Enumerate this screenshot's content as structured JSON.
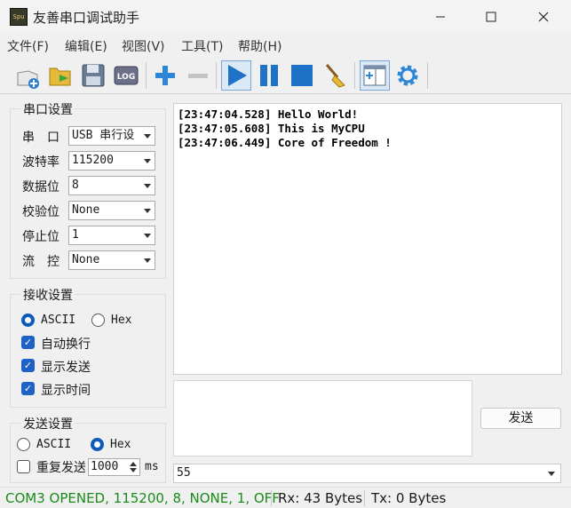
{
  "window": {
    "title": "友善串口调试助手",
    "icon_label": "Spu"
  },
  "menu": [
    "文件(F)",
    "编辑(E)",
    "视图(V)",
    "工具(T)",
    "帮助(H)"
  ],
  "toolbar": {
    "log_label": "LOG",
    "accent": "#1e73c8"
  },
  "serial_settings": {
    "title": "串口设置",
    "fields": [
      {
        "label": "串　口",
        "value": "USB 串行设"
      },
      {
        "label": "波特率",
        "value": "115200"
      },
      {
        "label": "数据位",
        "value": "8"
      },
      {
        "label": "校验位",
        "value": "None"
      },
      {
        "label": "停止位",
        "value": "1"
      },
      {
        "label": "流　控",
        "value": "None"
      }
    ]
  },
  "receive_settings": {
    "title": "接收设置",
    "ascii_label": "ASCII",
    "hex_label": "Hex",
    "selected": "ASCII",
    "checks": [
      {
        "label": "自动换行",
        "checked": true
      },
      {
        "label": "显示发送",
        "checked": true
      },
      {
        "label": "显示时间",
        "checked": true
      }
    ]
  },
  "send_settings": {
    "title": "发送设置",
    "ascii_label": "ASCII",
    "hex_label": "Hex",
    "selected": "Hex",
    "repeat_label": "重复发送",
    "repeat_checked": false,
    "interval_value": "1000",
    "interval_unit": "ms"
  },
  "receive_lines": [
    "[23:47:04.528] Hello World!",
    "[23:47:05.608] This is MyCPU",
    "[23:47:06.449] Core of Freedom !"
  ],
  "send": {
    "text": "",
    "button_label": "发送",
    "history_value": "55"
  },
  "status": {
    "connection": "COM3 OPENED, 115200, 8, NONE, 1, OFF",
    "connection_color": "#1a8a1a",
    "rx": "Rx: 43 Bytes",
    "tx": "Tx: 0 Bytes"
  }
}
